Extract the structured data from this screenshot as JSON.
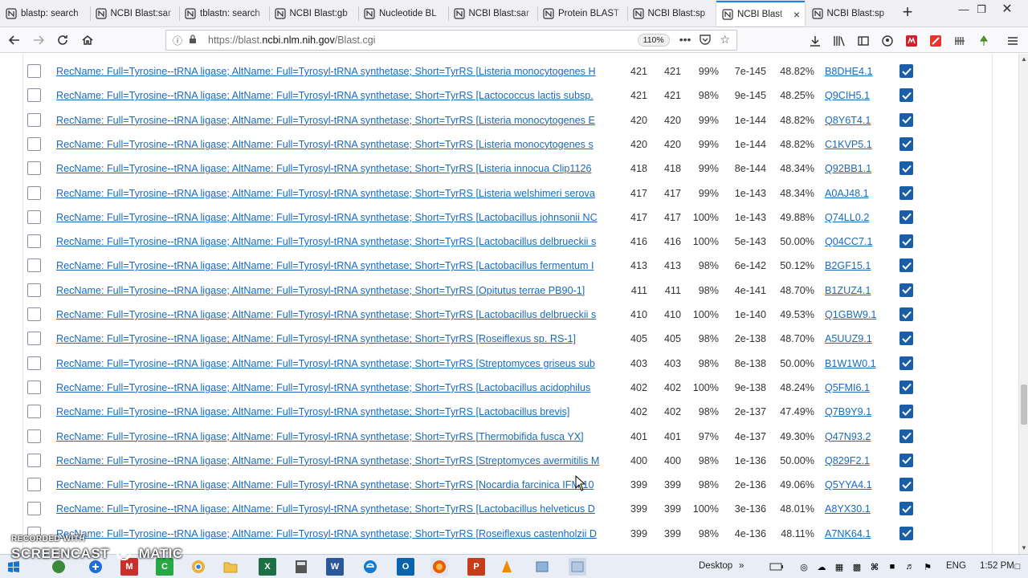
{
  "browser": {
    "tabs": [
      {
        "title": "blastp: search",
        "active": false
      },
      {
        "title": "NCBI Blast:sar",
        "active": false
      },
      {
        "title": "tblastn: search",
        "active": false
      },
      {
        "title": "NCBI Blast:gb",
        "active": false
      },
      {
        "title": "Nucleotide BL",
        "active": false
      },
      {
        "title": "NCBI Blast:sar",
        "active": false
      },
      {
        "title": "Protein BLAST",
        "active": false
      },
      {
        "title": "NCBI Blast:sp",
        "active": false
      },
      {
        "title": "NCBI Blast",
        "active": true
      },
      {
        "title": "NCBI Blast:sp",
        "active": false
      }
    ],
    "new_tab_label": "+",
    "url_prefix": "https://blast.",
    "url_host": "ncbi.nlm.nih.gov",
    "url_path": "/Blast.cgi",
    "zoom": "110%",
    "more_label": "•••",
    "close_label": "×"
  },
  "results": {
    "rows": [
      {
        "desc": "RecName: Full=Tyrosine--tRNA ligase; AltName: Full=Tyrosyl-tRNA synthetase; Short=TyrRS [Listeria monocytogenes H",
        "max": "421",
        "total": "421",
        "cover": "99%",
        "evalue": "7e-145",
        "ident": "48.82%",
        "acc": "B8DHE4.1"
      },
      {
        "desc": "RecName: Full=Tyrosine--tRNA ligase; AltName: Full=Tyrosyl-tRNA synthetase; Short=TyrRS [Lactococcus lactis subsp.",
        "max": "421",
        "total": "421",
        "cover": "98%",
        "evalue": "9e-145",
        "ident": "48.25%",
        "acc": "Q9CIH5.1"
      },
      {
        "desc": "RecName: Full=Tyrosine--tRNA ligase; AltName: Full=Tyrosyl-tRNA synthetase; Short=TyrRS [Listeria monocytogenes E",
        "max": "420",
        "total": "420",
        "cover": "99%",
        "evalue": "1e-144",
        "ident": "48.82%",
        "acc": "Q8Y6T4.1"
      },
      {
        "desc": "RecName: Full=Tyrosine--tRNA ligase; AltName: Full=Tyrosyl-tRNA synthetase; Short=TyrRS [Listeria monocytogenes s",
        "max": "420",
        "total": "420",
        "cover": "99%",
        "evalue": "1e-144",
        "ident": "48.82%",
        "acc": "C1KVP5.1"
      },
      {
        "desc": "RecName: Full=Tyrosine--tRNA ligase; AltName: Full=Tyrosyl-tRNA synthetase; Short=TyrRS [Listeria innocua Clip1126",
        "max": "418",
        "total": "418",
        "cover": "99%",
        "evalue": "8e-144",
        "ident": "48.34%",
        "acc": "Q92BB1.1"
      },
      {
        "desc": "RecName: Full=Tyrosine--tRNA ligase; AltName: Full=Tyrosyl-tRNA synthetase; Short=TyrRS [Listeria welshimeri serova",
        "max": "417",
        "total": "417",
        "cover": "99%",
        "evalue": "1e-143",
        "ident": "48.34%",
        "acc": "A0AJ48.1"
      },
      {
        "desc": "RecName: Full=Tyrosine--tRNA ligase; AltName: Full=Tyrosyl-tRNA synthetase; Short=TyrRS [Lactobacillus johnsonii NC",
        "max": "417",
        "total": "417",
        "cover": "100%",
        "evalue": "1e-143",
        "ident": "49.88%",
        "acc": "Q74LL0.2"
      },
      {
        "desc": "RecName: Full=Tyrosine--tRNA ligase; AltName: Full=Tyrosyl-tRNA synthetase; Short=TyrRS [Lactobacillus delbrueckii s",
        "max": "416",
        "total": "416",
        "cover": "100%",
        "evalue": "5e-143",
        "ident": "50.00%",
        "acc": "Q04CC7.1"
      },
      {
        "desc": "RecName: Full=Tyrosine--tRNA ligase; AltName: Full=Tyrosyl-tRNA synthetase; Short=TyrRS [Lactobacillus fermentum I",
        "max": "413",
        "total": "413",
        "cover": "98%",
        "evalue": "6e-142",
        "ident": "50.12%",
        "acc": "B2GF15.1"
      },
      {
        "desc": "RecName: Full=Tyrosine--tRNA ligase; AltName: Full=Tyrosyl-tRNA synthetase; Short=TyrRS [Opitutus terrae PB90-1]",
        "max": "411",
        "total": "411",
        "cover": "98%",
        "evalue": "4e-141",
        "ident": "48.70%",
        "acc": "B1ZUZ4.1"
      },
      {
        "desc": "RecName: Full=Tyrosine--tRNA ligase; AltName: Full=Tyrosyl-tRNA synthetase; Short=TyrRS [Lactobacillus delbrueckii s",
        "max": "410",
        "total": "410",
        "cover": "100%",
        "evalue": "1e-140",
        "ident": "49.53%",
        "acc": "Q1GBW9.1"
      },
      {
        "desc": "RecName: Full=Tyrosine--tRNA ligase; AltName: Full=Tyrosyl-tRNA synthetase; Short=TyrRS [Roseiflexus sp. RS-1]",
        "max": "405",
        "total": "405",
        "cover": "98%",
        "evalue": "2e-138",
        "ident": "48.70%",
        "acc": "A5UUZ9.1"
      },
      {
        "desc": "RecName: Full=Tyrosine--tRNA ligase; AltName: Full=Tyrosyl-tRNA synthetase; Short=TyrRS [Streptomyces griseus sub",
        "max": "403",
        "total": "403",
        "cover": "98%",
        "evalue": "8e-138",
        "ident": "50.00%",
        "acc": "B1W1W0.1"
      },
      {
        "desc": "RecName: Full=Tyrosine--tRNA ligase; AltName: Full=Tyrosyl-tRNA synthetase; Short=TyrRS [Lactobacillus acidophilus",
        "max": "402",
        "total": "402",
        "cover": "100%",
        "evalue": "9e-138",
        "ident": "48.24%",
        "acc": "Q5FMI6.1"
      },
      {
        "desc": "RecName: Full=Tyrosine--tRNA ligase; AltName: Full=Tyrosyl-tRNA synthetase; Short=TyrRS [Lactobacillus brevis]",
        "max": "402",
        "total": "402",
        "cover": "98%",
        "evalue": "2e-137",
        "ident": "47.49%",
        "acc": "Q7B9Y9.1"
      },
      {
        "desc": "RecName: Full=Tyrosine--tRNA ligase; AltName: Full=Tyrosyl-tRNA synthetase; Short=TyrRS [Thermobifida fusca YX]",
        "max": "401",
        "total": "401",
        "cover": "97%",
        "evalue": "4e-137",
        "ident": "49.30%",
        "acc": "Q47N93.2"
      },
      {
        "desc": "RecName: Full=Tyrosine--tRNA ligase; AltName: Full=Tyrosyl-tRNA synthetase; Short=TyrRS [Streptomyces avermitilis M",
        "max": "400",
        "total": "400",
        "cover": "98%",
        "evalue": "1e-136",
        "ident": "50.00%",
        "acc": "Q829F2.1"
      },
      {
        "desc": "RecName: Full=Tyrosine--tRNA ligase; AltName: Full=Tyrosyl-tRNA synthetase; Short=TyrRS [Nocardia farcinica IFM 10",
        "max": "399",
        "total": "399",
        "cover": "98%",
        "evalue": "2e-136",
        "ident": "49.06%",
        "acc": "Q5YYA4.1"
      },
      {
        "desc": "RecName: Full=Tyrosine--tRNA ligase; AltName: Full=Tyrosyl-tRNA synthetase; Short=TyrRS [Lactobacillus helveticus D",
        "max": "399",
        "total": "399",
        "cover": "100%",
        "evalue": "3e-136",
        "ident": "48.01%",
        "acc": "A8YX30.1"
      },
      {
        "desc": "RecName: Full=Tyrosine--tRNA ligase; AltName: Full=Tyrosyl-tRNA synthetase; Short=TyrRS [Roseiflexus castenholzii D",
        "max": "399",
        "total": "399",
        "cover": "98%",
        "evalue": "4e-136",
        "ident": "48.11%",
        "acc": "A7NK64.1"
      }
    ]
  },
  "taskbar": {
    "desktop_label": "Desktop",
    "language": "ENG",
    "time": "1:52 PM"
  },
  "watermark": {
    "line1": "RECORDED WITH",
    "line2": "SCREENCAST",
    "line3": "MATIC"
  },
  "colors": {
    "link": "#1a6abc",
    "active_tab_accent": "#0a84ff",
    "checkbox_checked": "#1a5ea8"
  }
}
